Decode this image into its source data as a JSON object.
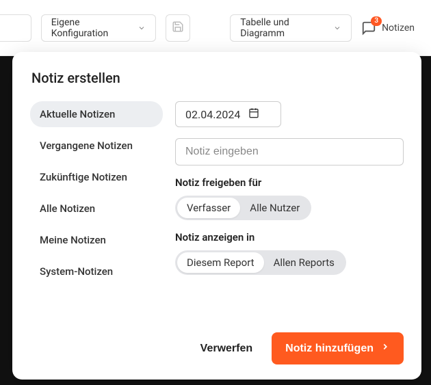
{
  "toolbar": {
    "config_label": "Eigene Konfiguration",
    "view_label": "Tabelle und Diagramm",
    "notes_label": "Notizen",
    "notes_badge": "3"
  },
  "modal": {
    "title": "Notiz erstellen",
    "sidebar": {
      "items": [
        {
          "label": "Aktuelle Notizen",
          "active": true
        },
        {
          "label": "Vergangene Notizen",
          "active": false
        },
        {
          "label": "Zukünftige Notizen",
          "active": false
        },
        {
          "label": "Alle Notizen",
          "active": false
        },
        {
          "label": "Meine Notizen",
          "active": false
        },
        {
          "label": "System-Notizen",
          "active": false
        }
      ]
    },
    "date_value": "02.04.2024",
    "note_placeholder": "Notiz eingeben",
    "share_label": "Notiz freigeben für",
    "share_options": [
      {
        "label": "Verfasser",
        "selected": true
      },
      {
        "label": "Alle Nutzer",
        "selected": false
      }
    ],
    "show_label": "Notiz anzeigen in",
    "show_options": [
      {
        "label": "Diesem Report",
        "selected": true
      },
      {
        "label": "Allen Reports",
        "selected": false
      }
    ],
    "discard_label": "Verwerfen",
    "submit_label": "Notiz hinzufügen"
  }
}
